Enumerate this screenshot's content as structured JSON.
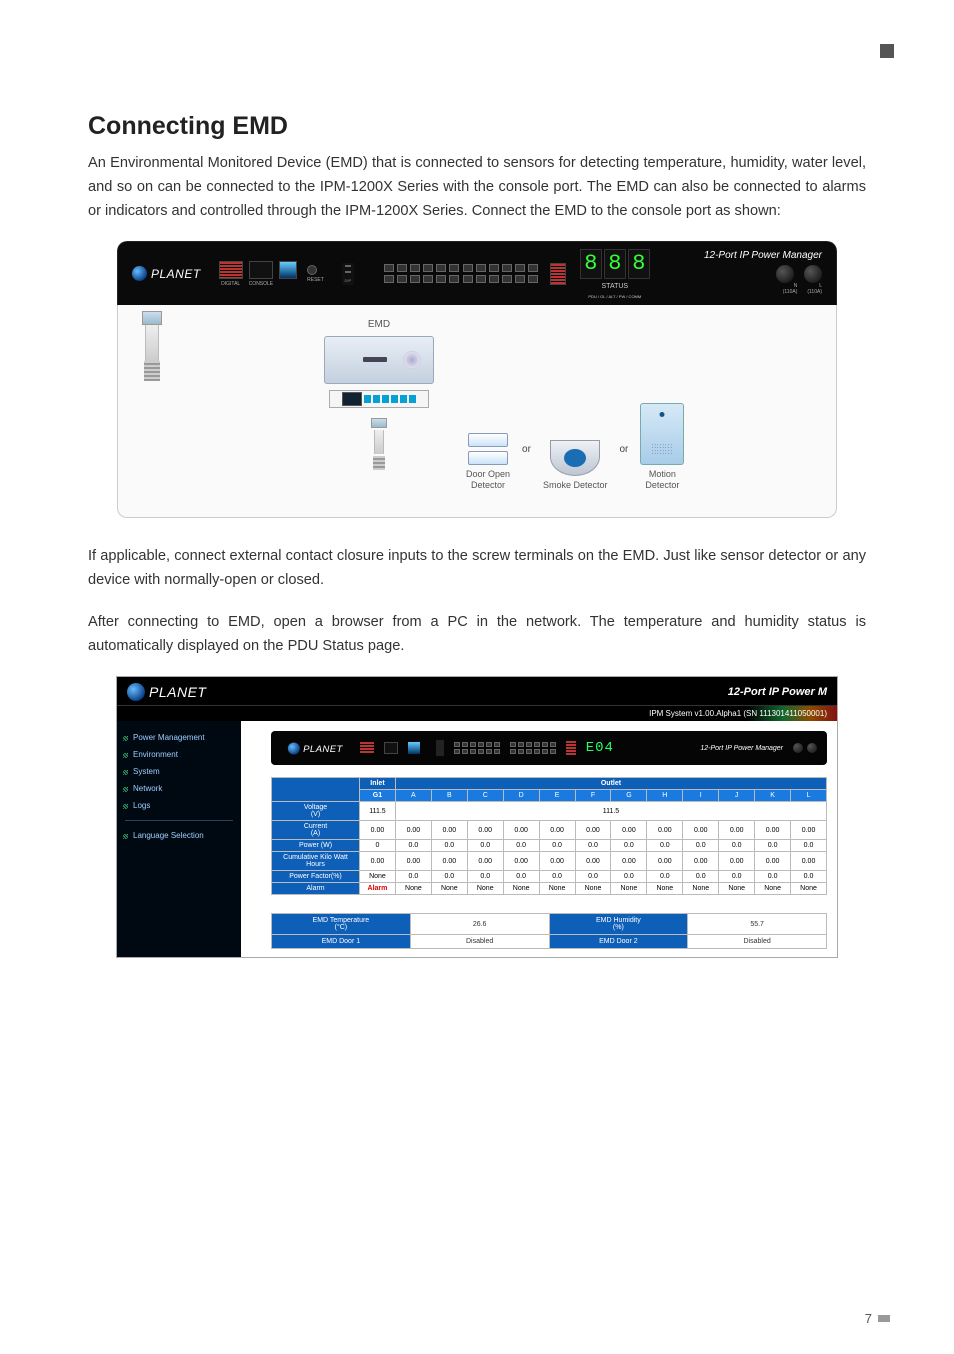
{
  "heading": "Connecting EMD",
  "para1": "An Environmental Monitored Device (EMD) that is connected to sensors for detecting temperature, humidity, water level, and so on can be connected to the IPM-1200X Series with the console port. The EMD can also be connected to alarms or indicators and controlled through the IPM-1200X Series. Connect the EMD to the console port as shown:",
  "fig1": {
    "logo_text": "PLANET",
    "device_title": "12-Port IP Power Manager",
    "status_label": "STATUS",
    "status_sub": "PDU / OL / ALT / PW / COMM",
    "seg_display": "888",
    "emd_label": "EMD",
    "or_text": "or",
    "detectors": {
      "door": "Door Open\nDetector",
      "smoke": "Smoke Detector",
      "motion": "Motion\nDetector"
    },
    "orb_labels": {
      "left": "N\n(110A)",
      "right": "L\n(110A)"
    }
  },
  "para2": "If applicable, connect external contact closure inputs to the screw terminals on the EMD. Just like sensor detector or any device with normally-open or closed.",
  "para3": "After connecting to EMD, open a browser from a PC in the network. The temperature and humidity status is automatically displayed on the PDU Status page.",
  "fig2": {
    "logo_text": "PLANET",
    "top_right_title": "12-Port IP Power M",
    "system_info": "IPM System v1.00.Alpha1 (SN 111301411050001)",
    "nav": [
      "Power Management",
      "Environment",
      "System",
      "Network",
      "Logs"
    ],
    "nav_lang": "Language Selection",
    "device_bar": {
      "seg": "E04",
      "strip_title": "12-Port IP Power Manager"
    },
    "table": {
      "inlet_label": "Inlet",
      "outlet_label": "Outlet",
      "g1": "G1",
      "cols": [
        "A",
        "B",
        "C",
        "D",
        "E",
        "F",
        "G",
        "H",
        "I",
        "J",
        "K",
        "L"
      ],
      "rows": [
        {
          "head": "Voltage\n(V)",
          "inlet": "111.5",
          "outlet_span": "111.5"
        },
        {
          "head": "Current\n(A)",
          "inlet": "0.00",
          "cells": [
            "0.00",
            "0.00",
            "0.00",
            "0.00",
            "0.00",
            "0.00",
            "0.00",
            "0.00",
            "0.00",
            "0.00",
            "0.00",
            "0.00"
          ]
        },
        {
          "head": "Power (W)",
          "inlet": "0",
          "cells": [
            "0.0",
            "0.0",
            "0.0",
            "0.0",
            "0.0",
            "0.0",
            "0.0",
            "0.0",
            "0.0",
            "0.0",
            "0.0",
            "0.0"
          ]
        },
        {
          "head": "Cumulative Kilo Watt\nHours",
          "inlet": "0.00",
          "cells": [
            "0.00",
            "0.00",
            "0.00",
            "0.00",
            "0.00",
            "0.00",
            "0.00",
            "0.00",
            "0.00",
            "0.00",
            "0.00",
            "0.00"
          ]
        },
        {
          "head": "Power Factor(%)",
          "inlet": "None",
          "cells": [
            "0.0",
            "0.0",
            "0.0",
            "0.0",
            "0.0",
            "0.0",
            "0.0",
            "0.0",
            "0.0",
            "0.0",
            "0.0",
            "0.0"
          ]
        },
        {
          "head": "Alarm",
          "inlet": "Alarm",
          "inlet_alarm": true,
          "cells": [
            "None",
            "None",
            "None",
            "None",
            "None",
            "None",
            "None",
            "None",
            "None",
            "None",
            "None",
            "None"
          ]
        }
      ]
    },
    "env": {
      "temp_label": "EMD Temperature\n(°C)",
      "temp_value": "26.6",
      "hum_label": "EMD Humidity\n(%)",
      "hum_value": "55.7",
      "door1_label": "EMD Door 1",
      "door1_value": "Disabled",
      "door2_label": "EMD Door 2",
      "door2_value": "Disabled"
    }
  },
  "page_number": "7"
}
